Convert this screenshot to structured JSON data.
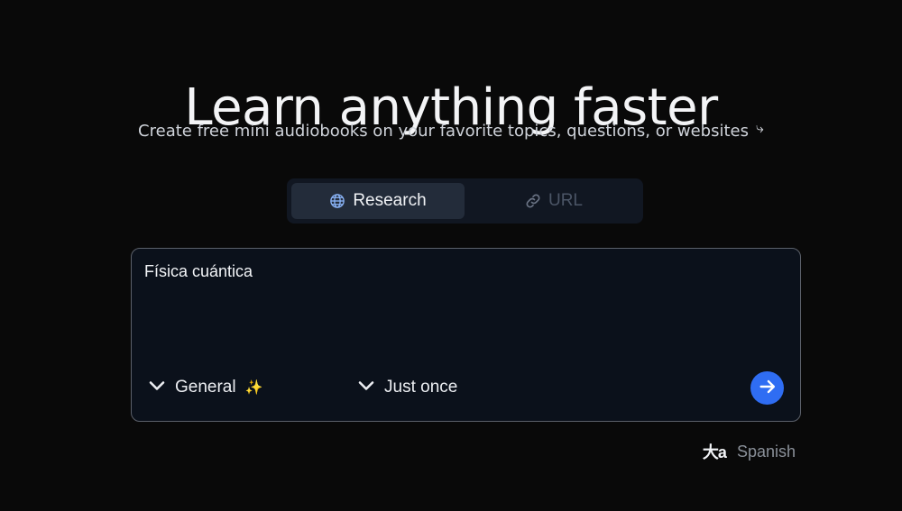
{
  "hero": {
    "title": "Learn anything faster",
    "subtitle": "Create free mini audiobooks on your favorite topics, questions, or websites",
    "subtitle_icon": "curved-arrow-down-right-icon"
  },
  "mode_switch": {
    "tabs": [
      {
        "label": "Research",
        "icon": "globe-icon",
        "active": true
      },
      {
        "label": "URL",
        "icon": "link-icon",
        "active": false
      }
    ]
  },
  "input": {
    "value": "Física cuántica",
    "style_dropdown": {
      "label": "General",
      "emoji": "✨"
    },
    "frequency_dropdown": {
      "label": "Just once"
    },
    "send_icon": "arrow-right-icon"
  },
  "language": {
    "icon": "translate-icon",
    "icon_text": "大a",
    "label": "Spanish"
  },
  "colors": {
    "background": "#090909",
    "accent": "#2f6df3",
    "card": "#0b111b"
  }
}
